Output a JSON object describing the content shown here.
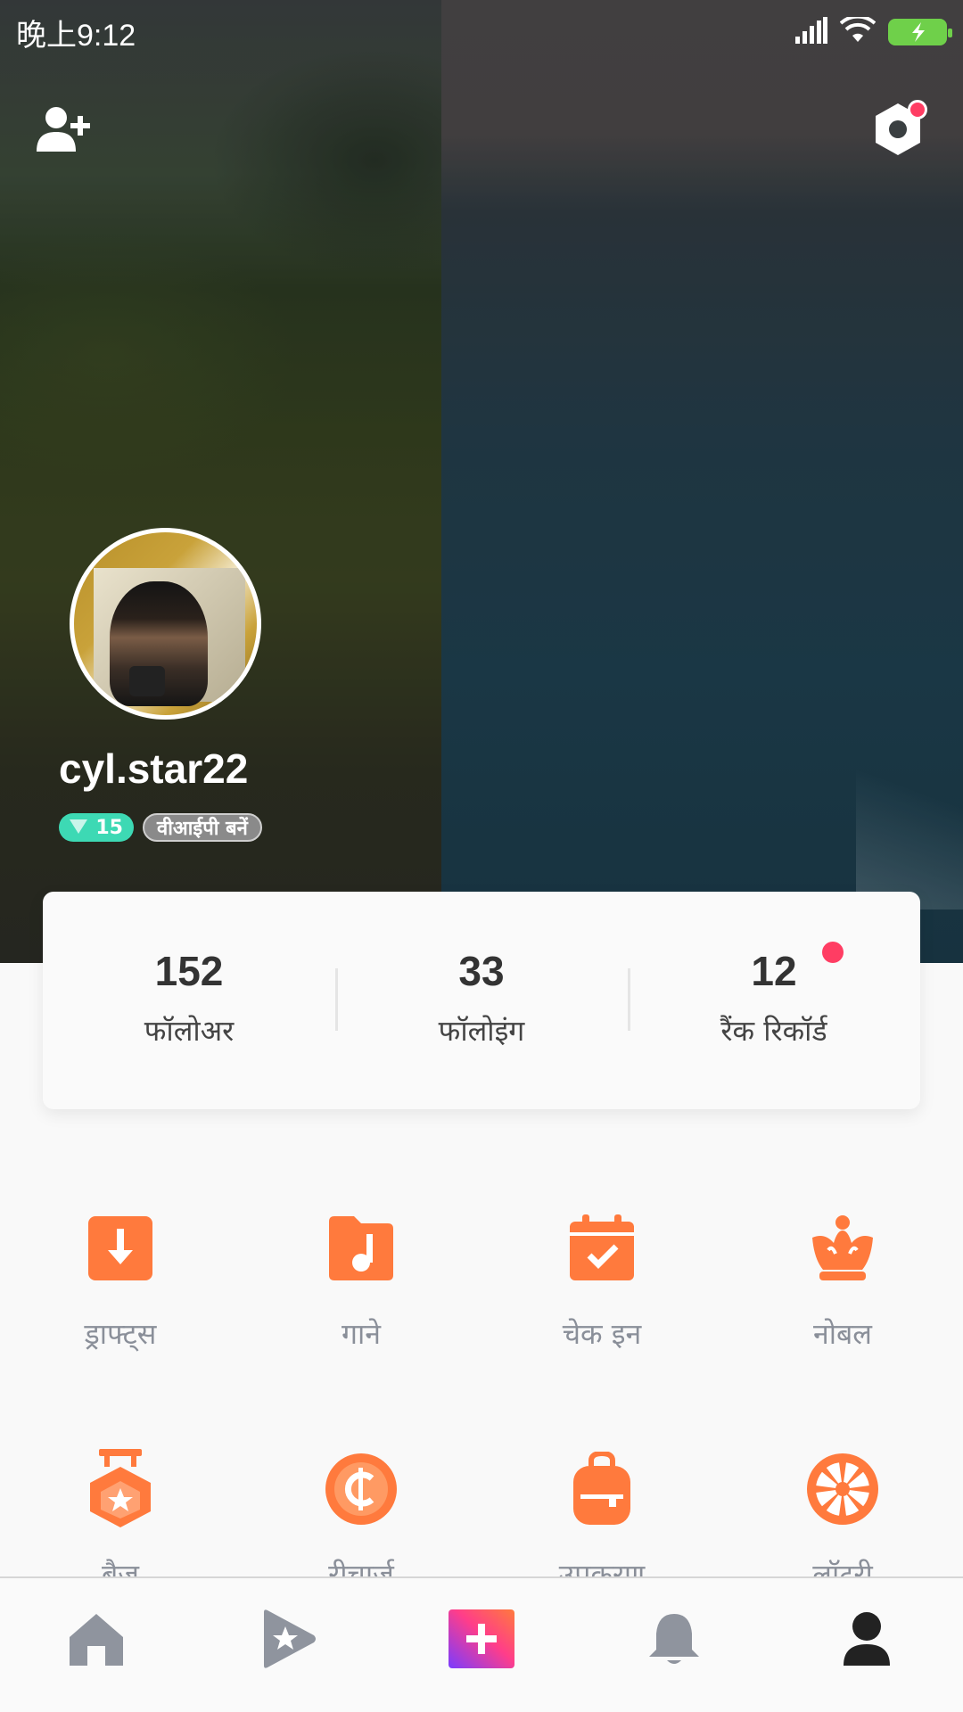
{
  "status_bar": {
    "time": "晚上9:12"
  },
  "profile": {
    "username": "cyl.star22",
    "level": "15",
    "vip_label": "वीआईपी बनें"
  },
  "stats": [
    {
      "value": "152",
      "label": "फॉलोअर"
    },
    {
      "value": "33",
      "label": "फॉलोइंग"
    },
    {
      "value": "12",
      "label": "रैंक रिकॉर्ड"
    }
  ],
  "menu": [
    {
      "label": "ड्राफ्ट्स",
      "icon": "drafts-download-icon"
    },
    {
      "label": "गाने",
      "icon": "songs-folder-icon"
    },
    {
      "label": "चेक इन",
      "icon": "check-in-calendar-icon"
    },
    {
      "label": "नोबल",
      "icon": "noble-crown-icon"
    },
    {
      "label": "बैज",
      "icon": "badge-medal-icon"
    },
    {
      "label": "रीचार्ज",
      "icon": "recharge-coin-icon"
    },
    {
      "label": "उपकरण",
      "icon": "backpack-icon"
    },
    {
      "label": "लॉटरी",
      "icon": "lottery-wheel-icon"
    }
  ],
  "bottom_nav": [
    "home-icon",
    "star-play-icon",
    "create-plus-icon",
    "notification-bell-icon",
    "profile-person-icon"
  ],
  "colors": {
    "accent": "#ff7a3d",
    "notification_dot": "#ff3d63",
    "level_badge": "#3dd9b4"
  }
}
